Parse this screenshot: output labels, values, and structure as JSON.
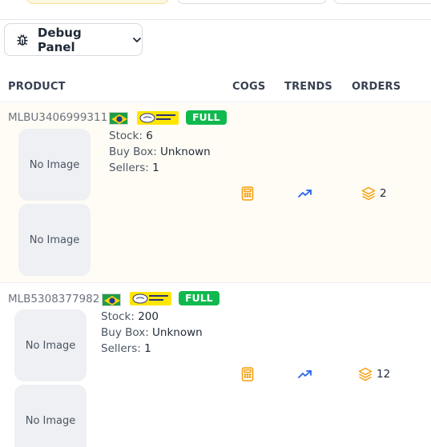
{
  "debug": {
    "label": "Debug Panel",
    "icon": "bug-icon"
  },
  "columns": {
    "product": "PRODUCT",
    "cogs": "COGS",
    "trends": "TRENDS",
    "orders": "ORDERS"
  },
  "rows": [
    {
      "sku": "MLBU3406999311",
      "flag": "brazil-flag",
      "marketplace_logo": "mercado-livre-logo",
      "badge": "FULL",
      "stock_label": "Stock:",
      "stock": "6",
      "buybox_label": "Buy Box:",
      "buybox": "Unknown",
      "sellers_label": "Sellers:",
      "sellers": "1",
      "images": [
        "No Image",
        "No Image"
      ],
      "orders": "2"
    },
    {
      "sku": "MLB5308377982",
      "flag": "brazil-flag",
      "marketplace_logo": "mercado-livre-logo",
      "badge": "FULL",
      "stock_label": "Stock:",
      "stock": "200",
      "buybox_label": "Buy Box:",
      "buybox": "Unknown",
      "sellers_label": "Sellers:",
      "sellers": "1",
      "images": [
        "No Image",
        "No Image"
      ],
      "orders": "12"
    }
  ],
  "colors": {
    "full_badge": "#10b94e",
    "mercado_yellow": "#ffe600",
    "cogs_icon": "#f59e0b",
    "trend_icon": "#2563eb",
    "row_highlight": "#fffcf5"
  }
}
